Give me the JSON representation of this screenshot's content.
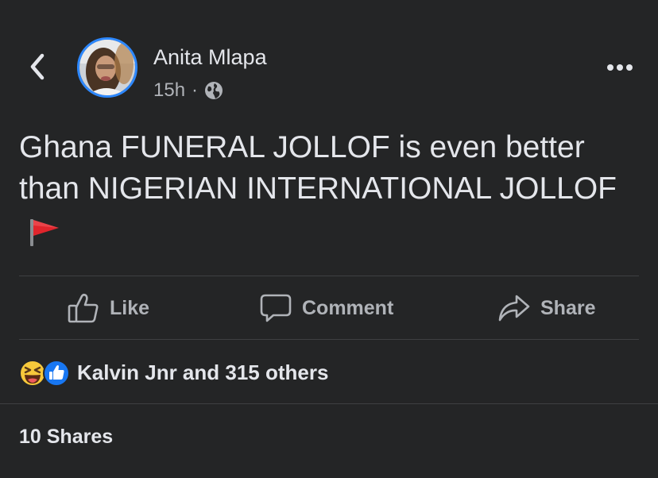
{
  "post": {
    "author": "Anita Mlapa",
    "time": "15h",
    "separator": "·",
    "privacy_icon": "globe-icon",
    "text": "Ghana FUNERAL JOLLOF is even better than NIGERIAN INTERNATIONAL JOLLOF",
    "trailing_emoji": "triangular-flag-icon"
  },
  "actions": {
    "like_label": "Like",
    "comment_label": "Comment",
    "share_label": "Share"
  },
  "reactions": {
    "icons": [
      "laughing-face-icon",
      "thumbs-up-icon"
    ],
    "summary": "Kalvin Jnr and 315 others"
  },
  "shares": {
    "label": "10 Shares"
  },
  "colors": {
    "background": "#242526",
    "primary_text": "#e4e6eb",
    "secondary_text": "#b0b3b8",
    "divider": "#3e4042",
    "story_ring": "#2d88ff",
    "like_blue": "#1877f2",
    "flag_red": "#e0252c"
  }
}
